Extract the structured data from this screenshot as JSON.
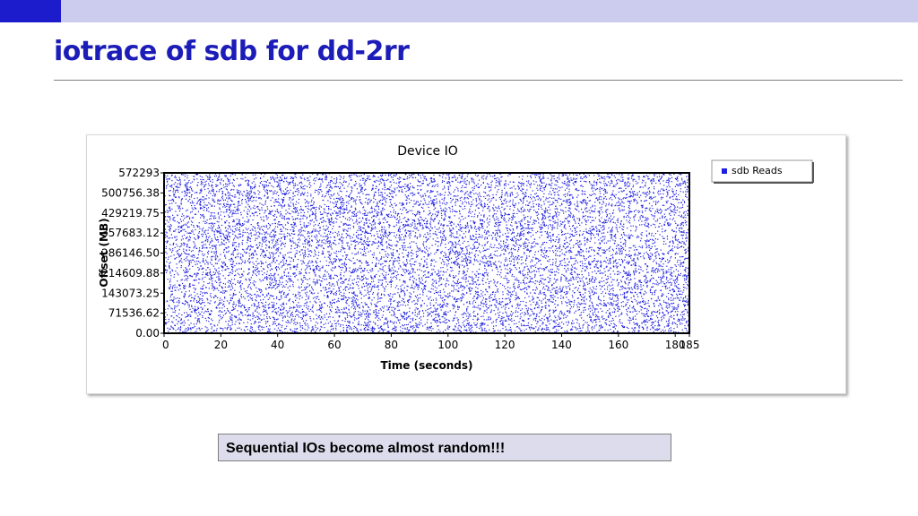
{
  "slide": {
    "title": "iotrace of sdb for dd-2rr",
    "callout": "Sequential IOs become almost random!!!"
  },
  "colors": {
    "accent": "#1c1ccc",
    "topbar": "#ccccee",
    "title": "#1c1cb8",
    "points": "#1f1fe0",
    "callout_bg": "#dcdcec"
  },
  "chart_data": {
    "type": "scatter",
    "title": "Device IO",
    "xlabel": "Time (seconds)",
    "ylabel": "Offset (MB)",
    "xlim": [
      0,
      185
    ],
    "ylim": [
      0,
      572293
    ],
    "x_ticks": [
      "0",
      "20",
      "40",
      "60",
      "80",
      "100",
      "120",
      "140",
      "160",
      "180",
      "185"
    ],
    "x_tick_values": [
      0,
      20,
      40,
      60,
      80,
      100,
      120,
      140,
      160,
      180,
      185
    ],
    "y_ticks": [
      "0.00",
      "71536.62",
      "143073.25",
      "214609.88",
      "286146.50",
      "357683.12",
      "429219.75",
      "500756.38",
      "572293"
    ],
    "y_tick_values": [
      0,
      71536.62,
      143073.25,
      214609.88,
      286146.5,
      357683.12,
      429219.75,
      500756.38,
      572293
    ],
    "grid": false,
    "legend": "top-right",
    "series": [
      {
        "name": "sdb Reads",
        "distribution": "uniform",
        "n_points": 12000,
        "x_range": [
          0,
          185
        ],
        "y_range": [
          0,
          572293
        ]
      }
    ]
  }
}
